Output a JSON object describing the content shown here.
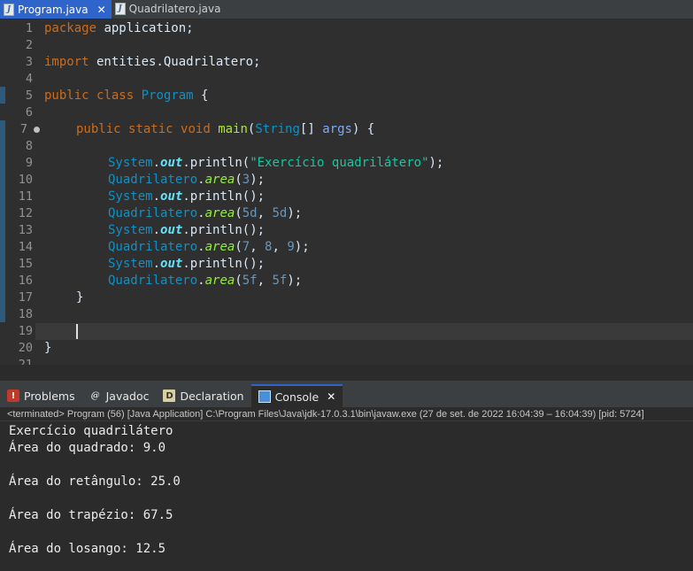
{
  "editor_tabs": [
    {
      "label": "Program.java",
      "active": true,
      "icon": "java-file-icon"
    },
    {
      "label": "Quadrilatero.java",
      "active": false,
      "icon": "java-file-icon"
    }
  ],
  "line_numbers": [
    "1",
    "2",
    "3",
    "4",
    "5",
    "6",
    "7",
    "8",
    "9",
    "10",
    "11",
    "12",
    "13",
    "14",
    "15",
    "16",
    "17",
    "18",
    "19",
    "20",
    "21"
  ],
  "code": {
    "l1": {
      "kw": "package",
      "rest": " application;"
    },
    "l3": {
      "kw": "import",
      "rest": " entities.Quadrilatero;"
    },
    "l5": {
      "kw1": "public",
      "kw2": "class",
      "cls": "Program",
      "rest": " {"
    },
    "l7": {
      "kw1": "public",
      "kw2": "static",
      "kw3": "void",
      "mth": "main",
      "p1": "(",
      "type": "String",
      "p2": "[] ",
      "arg": "args",
      "p3": ") {"
    },
    "l9": {
      "cls": "System",
      "dot1": ".",
      "fld": "out",
      "dot2": ".",
      "m": "println",
      "p1": "(",
      "str": "\"Exercício quadrilátero\"",
      "p2": ");"
    },
    "l10": {
      "cls": "Quadrilatero",
      "dot": ".",
      "m": "area",
      "p1": "(",
      "n1": "3",
      "p2": ");"
    },
    "l11": {
      "cls": "System",
      "dot1": ".",
      "fld": "out",
      "dot2": ".",
      "m": "println",
      "p": "();"
    },
    "l12": {
      "cls": "Quadrilatero",
      "dot": ".",
      "m": "area",
      "p1": "(",
      "n1": "5d",
      "c1": ", ",
      "n2": "5d",
      "p2": ");"
    },
    "l13": {
      "cls": "System",
      "dot1": ".",
      "fld": "out",
      "dot2": ".",
      "m": "println",
      "p": "();"
    },
    "l14": {
      "cls": "Quadrilatero",
      "dot": ".",
      "m": "area",
      "p1": "(",
      "n1": "7",
      "c1": ", ",
      "n2": "8",
      "c2": ", ",
      "n3": "9",
      "p2": ");"
    },
    "l15": {
      "cls": "System",
      "dot1": ".",
      "fld": "out",
      "dot2": ".",
      "m": "println",
      "p": "();"
    },
    "l16": {
      "cls": "Quadrilatero",
      "dot": ".",
      "m": "area",
      "p1": "(",
      "n1": "5f",
      "c1": ", ",
      "n2": "5f",
      "p2": ");"
    },
    "l17": "}",
    "l20": "}"
  },
  "hscroll_arrow": "<",
  "view_tabs": [
    {
      "label": "Problems",
      "icon": "problems-icon",
      "active": false
    },
    {
      "label": "Javadoc",
      "icon": "javadoc-icon",
      "active": false
    },
    {
      "label": "Declaration",
      "icon": "declaration-icon",
      "active": false
    },
    {
      "label": "Console",
      "icon": "console-icon",
      "active": true
    }
  ],
  "console_status": "<terminated> Program (56) [Java Application] C:\\Program Files\\Java\\jdk-17.0.3.1\\bin\\javaw.exe  (27 de set. de 2022 16:04:39 – 16:04:39) [pid: 5724]",
  "console_output": [
    "Exercício quadrilátero",
    "Área do quadrado: 9.0",
    "",
    "Área do retângulo: 25.0",
    "",
    "Área do trapézio: 67.5",
    "",
    "Área do losango: 12.5"
  ],
  "colors": {
    "keyword": "#cc6c1d",
    "class": "#1290c3",
    "string": "#17c6a3",
    "accent_tab": "#2f65ca"
  }
}
